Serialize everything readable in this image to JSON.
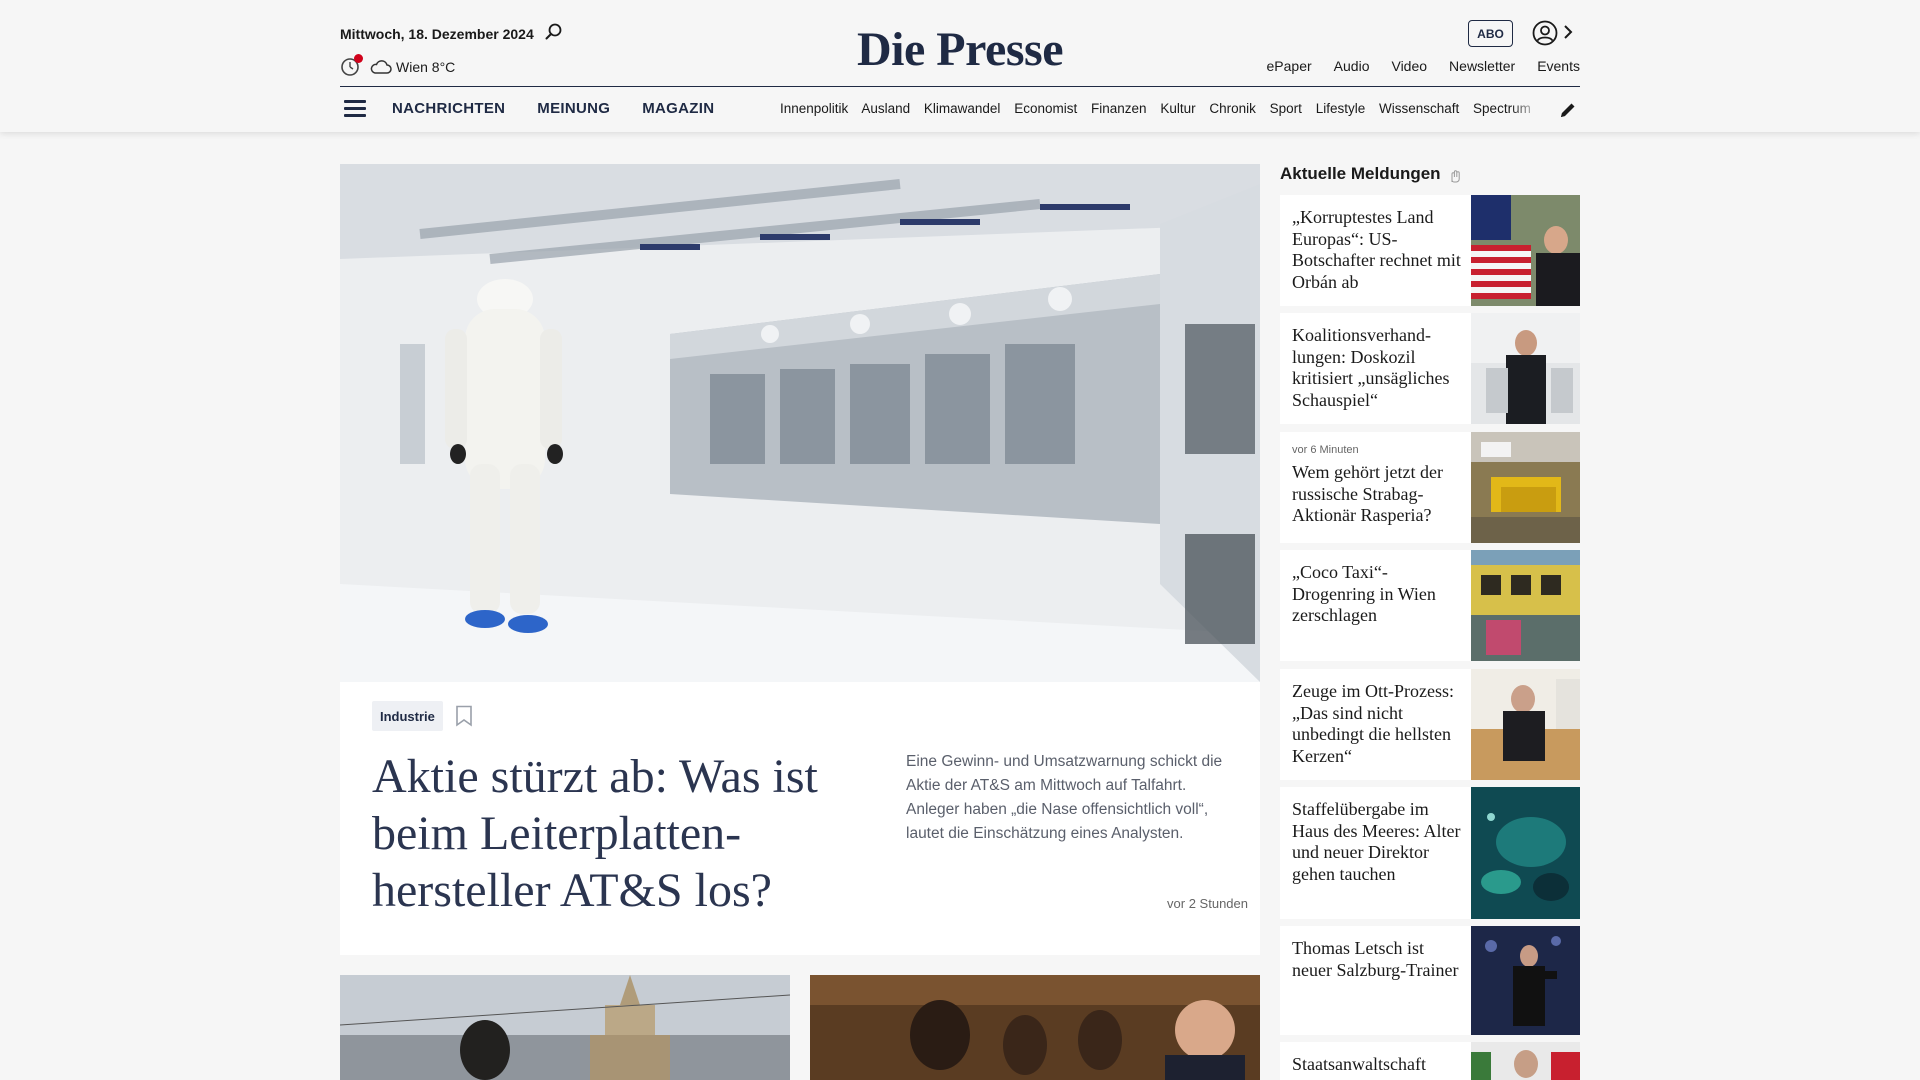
{
  "header": {
    "date": "Mittwoch, 18. Dezember 2024",
    "weather": "Wien 8°C",
    "logo": "Die Presse",
    "abo_label": "ABO",
    "service_links": [
      "ePaper",
      "Audio",
      "Video",
      "Newsletter",
      "Events"
    ],
    "main_nav": [
      "NACHRICHTEN",
      "MEINUNG",
      "MAGAZIN"
    ],
    "sub_nav": [
      "Innenpolitik",
      "Ausland",
      "Klimawandel",
      "Economist",
      "Finanzen",
      "Kultur",
      "Chronik",
      "Sport",
      "Lifestyle",
      "Wissenschaft",
      "Spectrum"
    ]
  },
  "lead": {
    "category": "Industrie",
    "headline": "Aktie stürzt ab: Was ist beim Leiterplatten-hersteller AT&S los?",
    "teaser": "Eine Gewinn- und Umsatzwarnung schickt die Aktie der AT&S am Mittwoch auf Talfahrt. Anleger haben „die Nase offensichtlich voll“, lautet die Einschätzung eines Analysten.",
    "time": "vor 2 Stunden"
  },
  "aside": {
    "title": "Aktuelle Meldungen",
    "items": [
      {
        "meta": "",
        "title": "„Korruptestes Land Europas“: US-Botschafter rechnet mit Orbán ab"
      },
      {
        "meta": "",
        "title": "Koalitionsverhand-lungen: Doskozil kritisiert „unsägliches Schauspiel“"
      },
      {
        "meta": "vor 6 Minuten",
        "title": "Wem gehört jetzt der russische Strabag-Aktionär Rasperia?"
      },
      {
        "meta": "",
        "title": "„Coco Taxi“-Drogenring in Wien zerschlagen"
      },
      {
        "meta": "",
        "title": "Zeuge im Ott-Prozess: „Das sind nicht unbedingt die hellsten Kerzen“"
      },
      {
        "meta": "",
        "title": "Staffelübergabe im Haus des Meeres: Alter und neuer Direktor gehen tauchen"
      },
      {
        "meta": "",
        "title": "Thomas Letsch ist neuer Salzburg-Trainer"
      },
      {
        "meta": "",
        "title": "Staatsanwaltschaft"
      }
    ]
  },
  "colors": {
    "brand_navy": "#1f2a44",
    "notification_red": "#d0021b",
    "background": "#f6f6f6"
  },
  "icons": [
    "search-icon",
    "night-mode-icon",
    "cloud-icon",
    "user-icon",
    "chevron-right-icon",
    "menu-icon",
    "pencil-icon",
    "bookmark-icon",
    "hand-icon"
  ]
}
